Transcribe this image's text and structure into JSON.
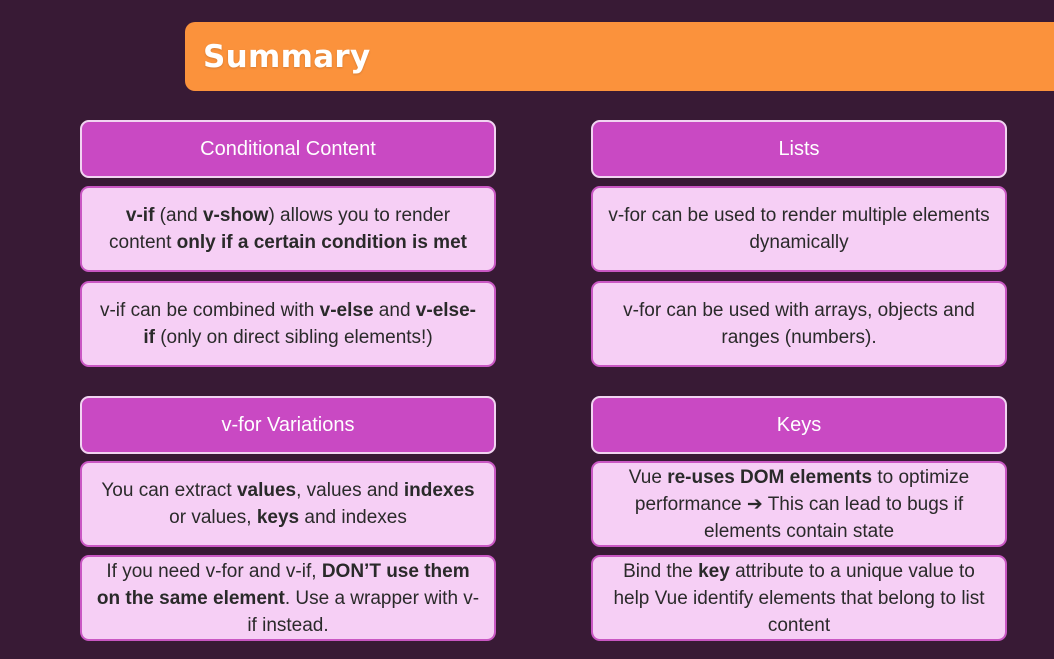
{
  "slide": {
    "title": "Summary"
  },
  "sections": {
    "conditional": {
      "heading": "Conditional Content",
      "box1": {
        "p1": "v-if",
        "p2": " (and ",
        "p3": "v-show",
        "p4": ") allows you to render content ",
        "p5": "only if a certain condition is met"
      },
      "box2": {
        "p1": "v-if can be combined with ",
        "p2": "v-else",
        "p3": " and ",
        "p4": "v-else-if",
        "p5": " (only on direct sibling elements!)"
      }
    },
    "lists": {
      "heading": "Lists",
      "box1": "v-for can be used to render multiple elements dynamically",
      "box2": "v-for can be used with arrays, objects and ranges (numbers)."
    },
    "variations": {
      "heading": "v-for Variations",
      "box1": {
        "p1": "You can extract ",
        "p2": "values",
        "p3": ", values and ",
        "p4": "indexes",
        "p5": " or values, ",
        "p6": "keys",
        "p7": " and indexes"
      },
      "box2": {
        "p1": "If you need v-for and v-if, ",
        "p2": "DON’T use them on the same element",
        "p3": ". Use a wrapper with v-if instead."
      }
    },
    "keys": {
      "heading": "Keys",
      "box1": {
        "p1": "Vue ",
        "p2": "re-uses DOM elements",
        "p3": " to optimize performance ",
        "arrow": "➔",
        "p4": " This can lead to bugs if elements contain state"
      },
      "box2": {
        "p1": "Bind the ",
        "p2": "key",
        "p3": " attribute to a unique value to help Vue identify elements that belong to list content"
      }
    }
  },
  "colors": {
    "background": "#381a35",
    "title_bar": "#fb923c",
    "heading_box": "#c949c3",
    "body_box": "#f6cff5"
  }
}
